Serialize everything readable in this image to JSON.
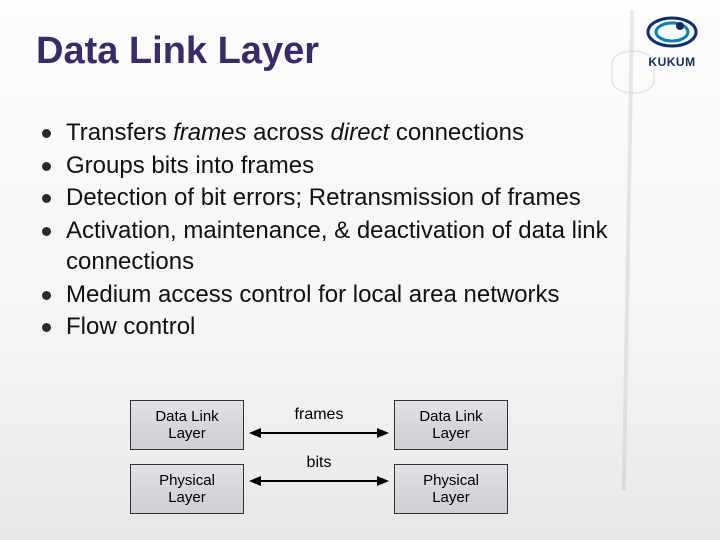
{
  "logo": {
    "text": "KUKUM"
  },
  "title": "Data Link Layer",
  "bullets": [
    {
      "pre": "Transfers ",
      "i1": "frames",
      "mid": " across ",
      "i2": "direct",
      "post": " connections"
    },
    {
      "text": "Groups bits into frames"
    },
    {
      "text": "Detection of bit errors;  Retransmission of frames"
    },
    {
      "text": "Activation, maintenance, & deactivation of data link connections"
    },
    {
      "text": "Medium access control for local area networks"
    },
    {
      "text": "Flow control"
    }
  ],
  "diagram": {
    "left": {
      "top": "Data Link\nLayer",
      "bottom": "Physical\nLayer"
    },
    "right": {
      "top": "Data Link\nLayer",
      "bottom": "Physical\nLayer"
    },
    "labels": {
      "top": "frames",
      "bottom": "bits"
    }
  }
}
